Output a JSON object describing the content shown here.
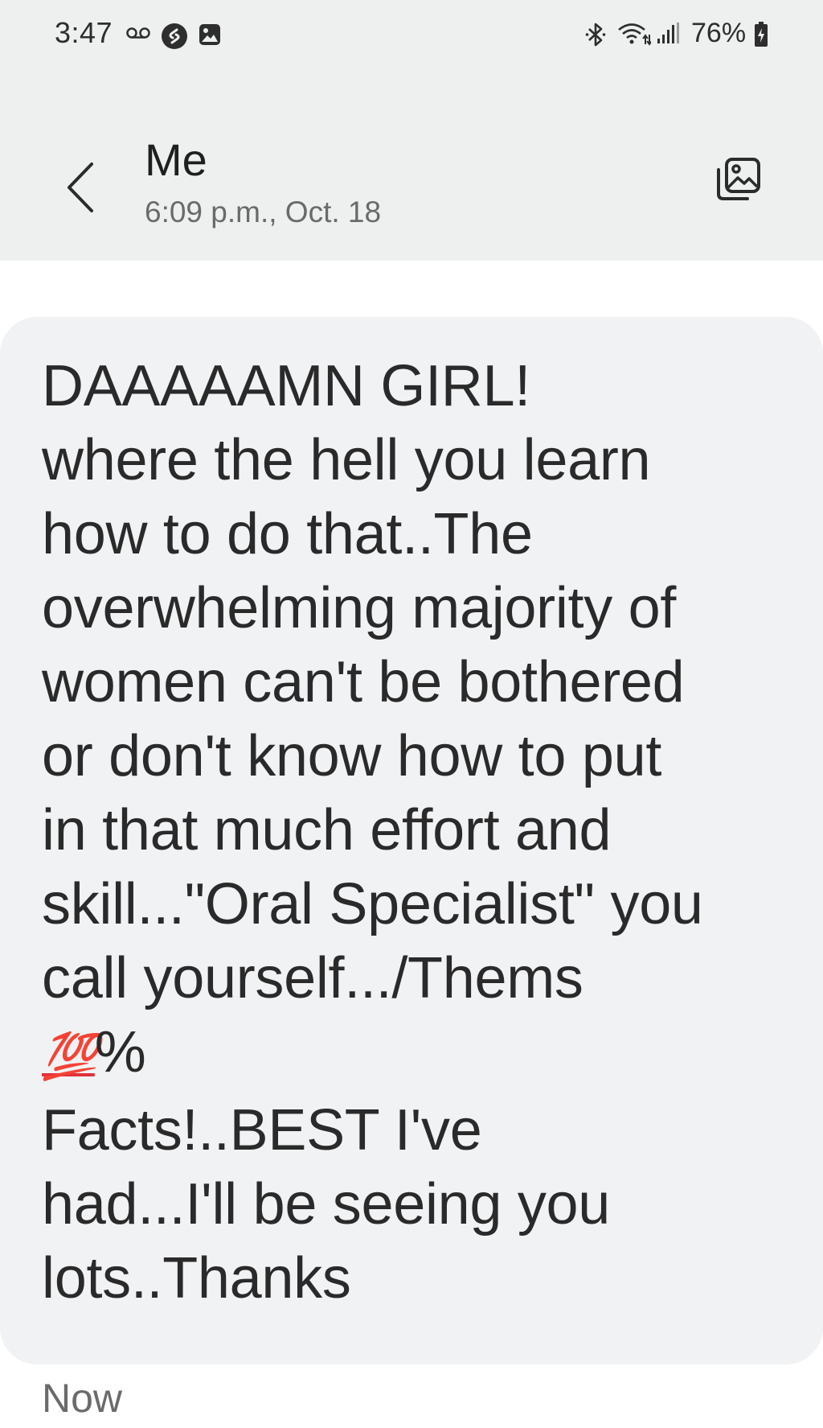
{
  "status_bar": {
    "time": "3:47",
    "battery": "76%",
    "icons": [
      "voicemail-icon",
      "shazam-icon",
      "gallery-icon",
      "bluetooth-icon",
      "wifi-icon",
      "signal-icon",
      "battery-charging-icon"
    ]
  },
  "header": {
    "contact_name": "Me",
    "datetime": "6:09 p.m., Oct. 18",
    "back_icon": "chevron-left-icon",
    "gallery_icon": "gallery-icon"
  },
  "message": {
    "text_part1": "DAAAAAMN GIRL!\nwhere the hell you learn\nhow to do that..The\noverwhelming majority of\nwomen can't be bothered\nor don't know how to put\nin that much effort and\nskill...\"Oral Specialist\" you\ncall yourself.../Thems\n",
    "emoji": "💯",
    "text_part2": "%\nFacts!..BEST I've\nhad...I'll be seeing you\nlots..Thanks",
    "status": "Now"
  },
  "colors": {
    "header_bg": "#eef0f0",
    "bubble_bg": "#f1f2f4",
    "text": "#2a2a2a",
    "secondary_text": "#6a6a6a",
    "emoji_red": "#e0313a"
  }
}
